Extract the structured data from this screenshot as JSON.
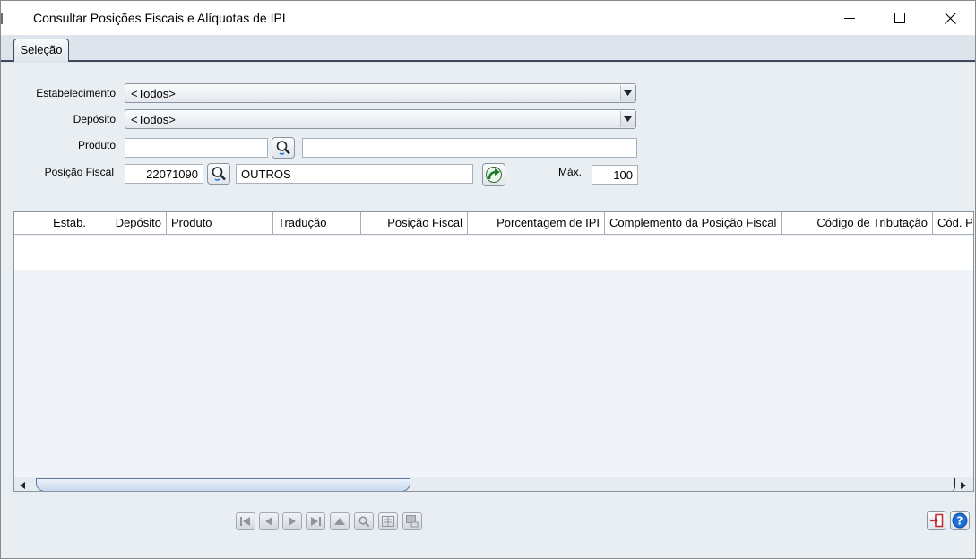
{
  "window": {
    "title": "Consultar Posições Fiscais e Alíquotas de IPI"
  },
  "tabs": [
    {
      "label": "Seleção",
      "active": true
    }
  ],
  "form": {
    "estabelecimento": {
      "label": "Estabelecimento",
      "value": "<Todos>"
    },
    "deposito": {
      "label": "Depósito",
      "value": "<Todos>"
    },
    "produto": {
      "label": "Produto",
      "code": "",
      "description": ""
    },
    "posicao_fiscal": {
      "label": "Posição Fiscal",
      "code": "22071090",
      "description": "OUTROS"
    },
    "max": {
      "label": "Máx.",
      "value": "100"
    }
  },
  "grid": {
    "columns": [
      "Estab.",
      "Depósito",
      "Produto",
      "Tradução",
      "Posição Fiscal",
      "Porcentagem de IPI",
      "Complemento da Posição Fiscal",
      "Código de Tributação",
      "Cód. P"
    ],
    "rows": []
  },
  "icons": {
    "search": "magnifier-icon",
    "execute": "green-arrow-icon",
    "exit": "exit-door-icon",
    "help": "help-icon"
  },
  "colors": {
    "accent_dark": "#3c4a5c",
    "scroll_thumb": "#c9d9ec",
    "help_blue": "#1d6fd6",
    "exit_red": "#c0262d"
  }
}
